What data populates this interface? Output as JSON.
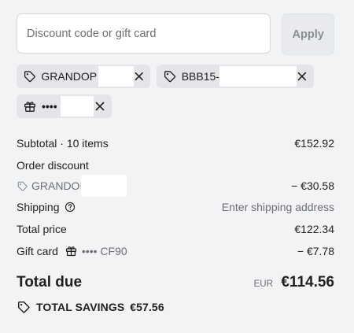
{
  "discount": {
    "placeholder": "Discount code or gift card",
    "apply_label": "Apply"
  },
  "chips": [
    {
      "label": "GRANDOP",
      "icon": "tag-icon"
    },
    {
      "label": "BBB15-",
      "icon": "tag-icon"
    },
    {
      "label": "••••",
      "icon": "gift-icon"
    }
  ],
  "summary": {
    "subtotal_label": "Subtotal · 10 items",
    "subtotal_value": "€152.92",
    "order_discount_label": "Order discount",
    "order_discount_code": "GRANDOI",
    "order_discount_value": "− €30.58",
    "shipping_label": "Shipping",
    "shipping_value": "Enter shipping address",
    "total_price_label": "Total price",
    "total_price_value": "€122.34",
    "gift_card_label": "Gift card",
    "gift_card_code": "•••• CF90",
    "gift_card_value": "− €7.78"
  },
  "total_due": {
    "label": "Total due",
    "currency": "EUR",
    "amount": "€114.56"
  },
  "savings": {
    "label": "TOTAL SAVINGS",
    "amount": "€57.56"
  }
}
